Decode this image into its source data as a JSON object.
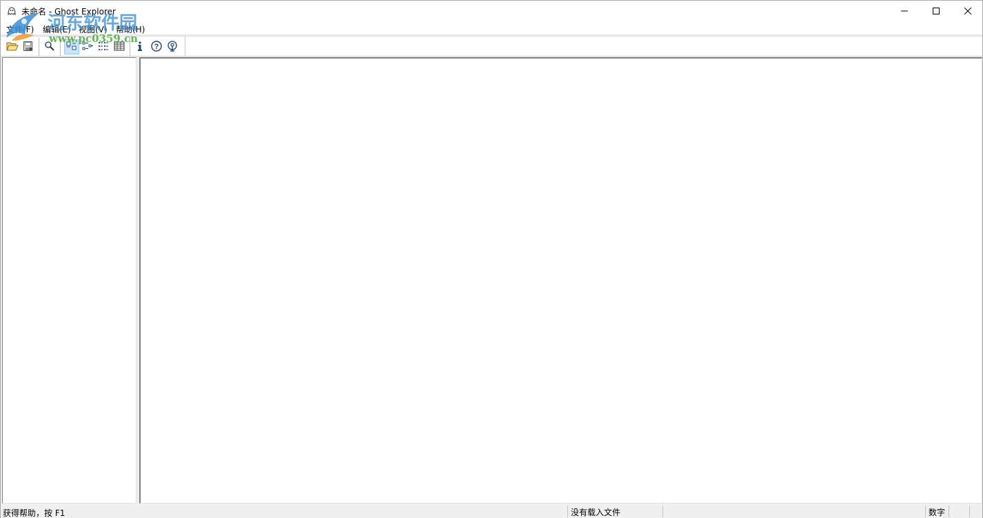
{
  "window": {
    "title": "未命名 - Ghost Explorer",
    "buttons": {
      "minimize": "minimize-icon",
      "maximize": "maximize-icon",
      "close": "close-icon"
    }
  },
  "watermark": {
    "title": "河东软件园",
    "url": "www.pc0359.cn"
  },
  "menubar": {
    "items": [
      {
        "label": "文件(F)"
      },
      {
        "label": "编辑(E)"
      },
      {
        "label": "视图(V)"
      },
      {
        "label": "帮助(H)"
      }
    ]
  },
  "toolbar": {
    "buttons": [
      {
        "icon": "open-folder-icon"
      },
      {
        "icon": "save-icon"
      },
      {
        "icon": "search-icon"
      },
      {
        "icon": "large-icons-view-icon",
        "pressed": true
      },
      {
        "icon": "small-icons-view-icon"
      },
      {
        "icon": "list-view-icon"
      },
      {
        "icon": "details-view-icon"
      },
      {
        "icon": "info-icon"
      },
      {
        "icon": "help-icon"
      },
      {
        "icon": "antenna-icon"
      }
    ]
  },
  "statusbar": {
    "help_text": "获得帮助，按 F1",
    "file_status": "没有载入文件",
    "extra": "",
    "num_lock": "数字",
    "scroll": "",
    "last": ""
  },
  "colors": {
    "watermark_blue": "#3a8fd6",
    "watermark_green": "#4aa83e",
    "pressed_bg": "#cce4f7"
  }
}
